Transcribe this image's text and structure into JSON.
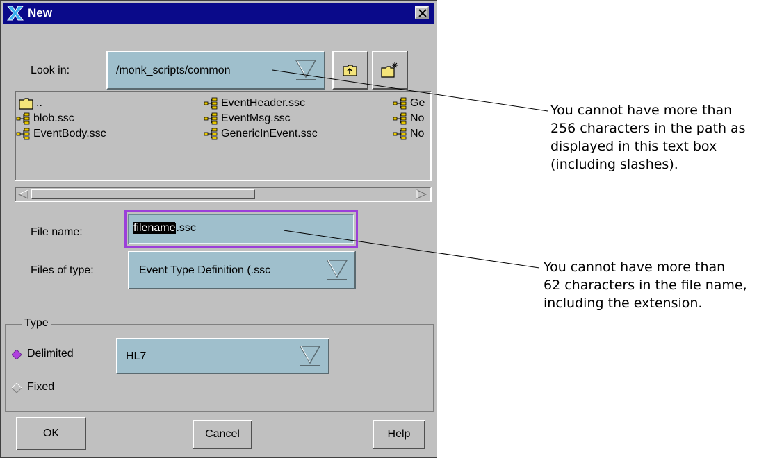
{
  "window": {
    "title": "New"
  },
  "look_in": {
    "label": "Look in:",
    "value": "/monk_scripts/common"
  },
  "files": [
    [
      {
        "name": "..",
        "type": "folder"
      },
      {
        "name": "blob.ssc",
        "type": "script"
      },
      {
        "name": "EventBody.ssc",
        "type": "script"
      }
    ],
    [
      {
        "name": "EventHeader.ssc",
        "type": "script"
      },
      {
        "name": "EventMsg.ssc",
        "type": "script"
      },
      {
        "name": "GenericInEvent.ssc",
        "type": "script"
      }
    ],
    [
      {
        "name": "Ge",
        "type": "script"
      },
      {
        "name": "No",
        "type": "script"
      },
      {
        "name": "No",
        "type": "script"
      }
    ]
  ],
  "file_name": {
    "label": "File name:",
    "selected_part": "filename",
    "rest": ".ssc"
  },
  "files_of_type": {
    "label": "Files of type:",
    "value": "Event Type Definition (.ssc"
  },
  "type_group": {
    "legend": "Type",
    "delimited_label": "Delimited",
    "fixed_label": "Fixed",
    "selected": "Delimited",
    "delimiter_value": "HL7"
  },
  "buttons": {
    "ok": "OK",
    "cancel": "Cancel",
    "help": "Help"
  },
  "annotations": {
    "path_note": [
      "You cannot have more than",
      "256 characters in the path as",
      "displayed in this text box",
      "(including slashes)."
    ],
    "filename_note": [
      "You cannot have more than",
      "62 characters in the file name,",
      "including the extension."
    ]
  },
  "colors": {
    "titlebar": "#0a0a8a",
    "field": "#9fbfcc",
    "focus": "#9b3fd9",
    "dialog": "#c0c0c0"
  }
}
